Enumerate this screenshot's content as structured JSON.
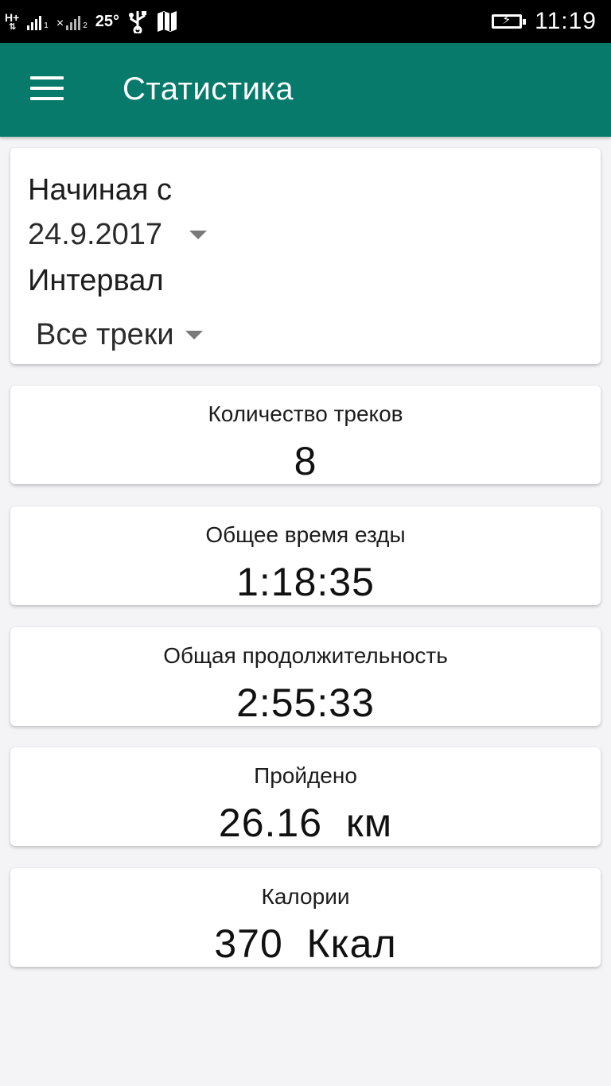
{
  "status_bar": {
    "network_type": "H+",
    "sim1_index": "1",
    "sim2_index": "2",
    "temperature": "25°",
    "time": "11:19",
    "icons": [
      "signal-icon",
      "no-signal-icon",
      "usb-icon",
      "map-icon",
      "battery-charging-icon"
    ]
  },
  "app_bar": {
    "title": "Статистика",
    "menu_icon": "hamburger-menu-icon",
    "background_color": "#077a6c"
  },
  "filter": {
    "start_label": "Начиная с",
    "start_date": "24.9.2017",
    "interval_label": "Интервал",
    "interval_value": "Все треки"
  },
  "stats": [
    {
      "label": "Количество треков",
      "value": "8"
    },
    {
      "label": "Общее время езды",
      "value": "1:18:35"
    },
    {
      "label": "Общая продолжительность",
      "value": "2:55:33"
    },
    {
      "label": "Пройдено",
      "value": "26.16  км"
    },
    {
      "label": "Калории",
      "value": "370  Ккал"
    }
  ]
}
